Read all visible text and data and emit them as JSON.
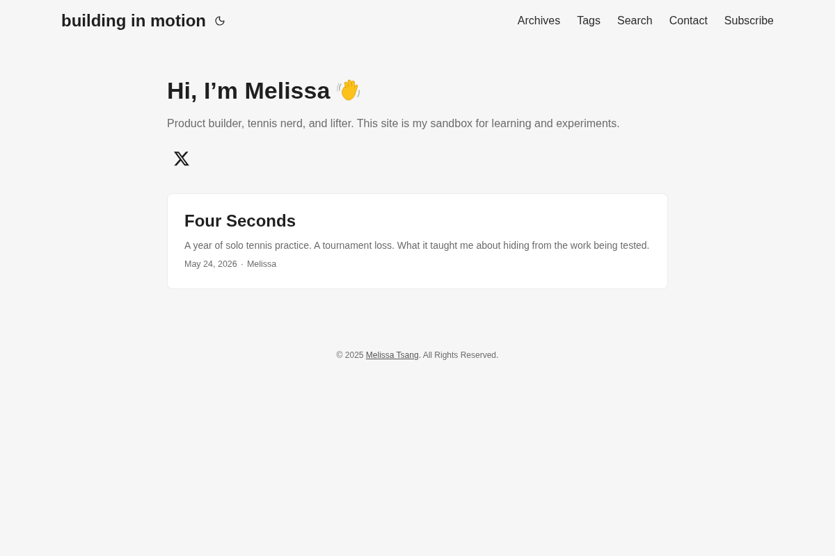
{
  "header": {
    "site_title": "building in motion",
    "nav": [
      "Archives",
      "Tags",
      "Search",
      "Contact",
      "Subscribe"
    ]
  },
  "intro": {
    "heading": "Hi, I’m Melissa",
    "subtitle": "Product builder, tennis nerd, and lifter. This site is my sandbox for learning and experiments."
  },
  "posts": [
    {
      "title": "Four Seconds",
      "description": "A year of solo tennis practice. A tournament loss. What it taught me about hiding from the work being tested.",
      "date": "May 24, 2026",
      "separator": "·",
      "author": "Melissa"
    }
  ],
  "footer": {
    "prefix": "© 2025",
    "link": "Melissa Tsang",
    "suffix": ". All Rights Reserved."
  }
}
